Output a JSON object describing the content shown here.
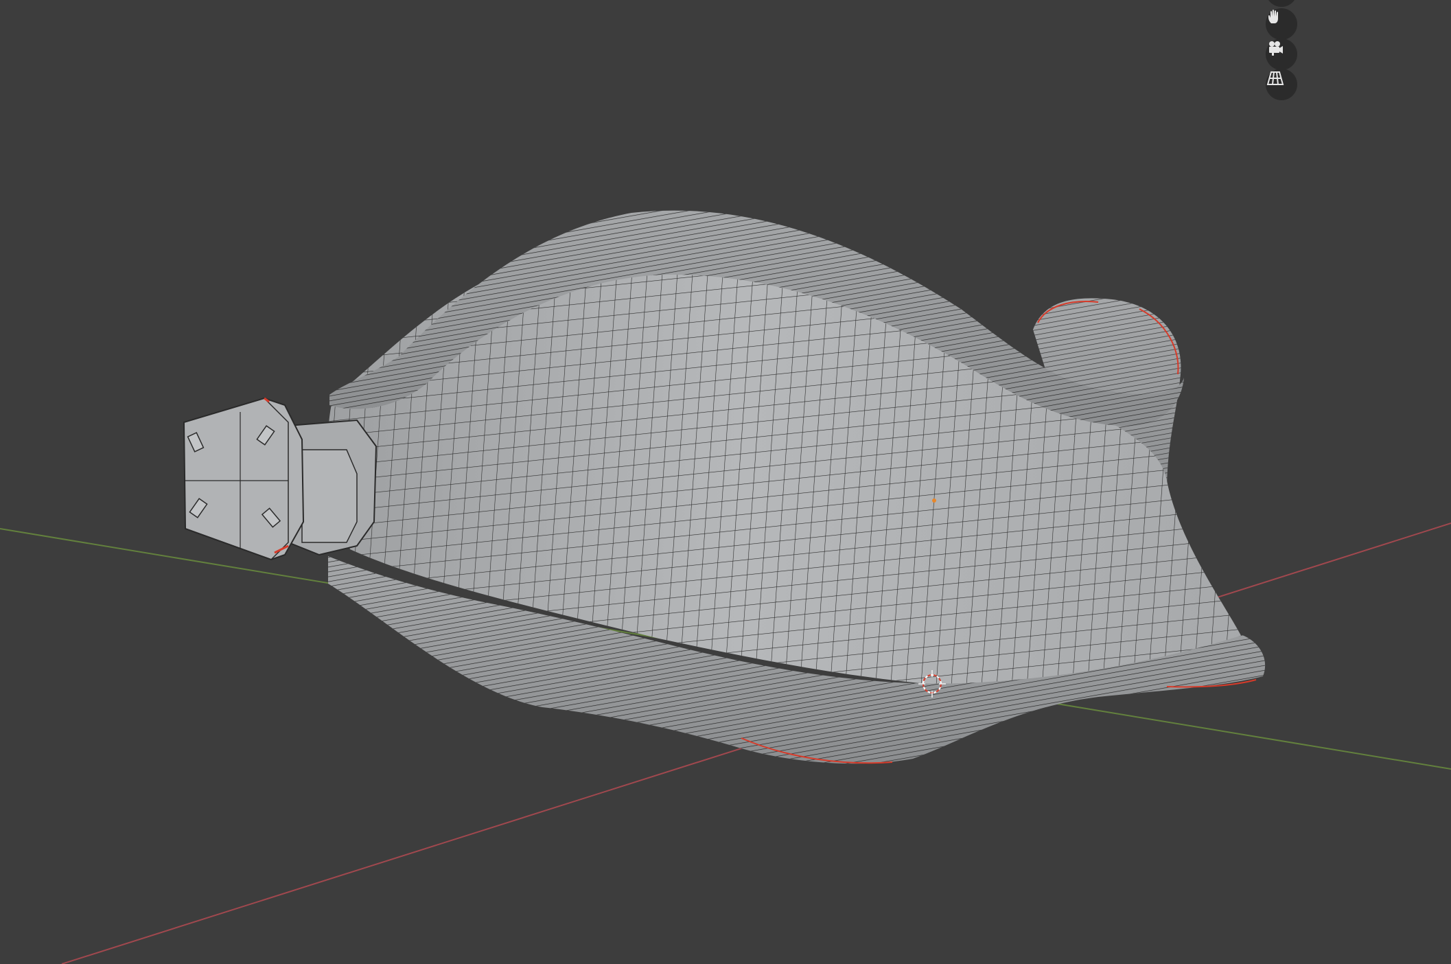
{
  "app": {
    "name": "",
    "view": "3D Viewport"
  },
  "viewport": {
    "background_color": "#3d3d3d",
    "axis_x_color": "#b34a52",
    "axis_y_color": "#6a8d3e",
    "mesh_color": "#a9aaab",
    "wire_color": "#202020",
    "seam_color": "#d63b2a"
  },
  "navigation_gizmo": {
    "buttons": [
      {
        "name": "pan-view",
        "icon": "hand-icon"
      },
      {
        "name": "toggle-camera-view",
        "icon": "camera-icon"
      },
      {
        "name": "toggle-projection",
        "icon": "grid-perspective-icon"
      }
    ]
  },
  "scene": {
    "object": "collar-mesh",
    "cursor": "3d-cursor",
    "origin": "object-origin"
  }
}
